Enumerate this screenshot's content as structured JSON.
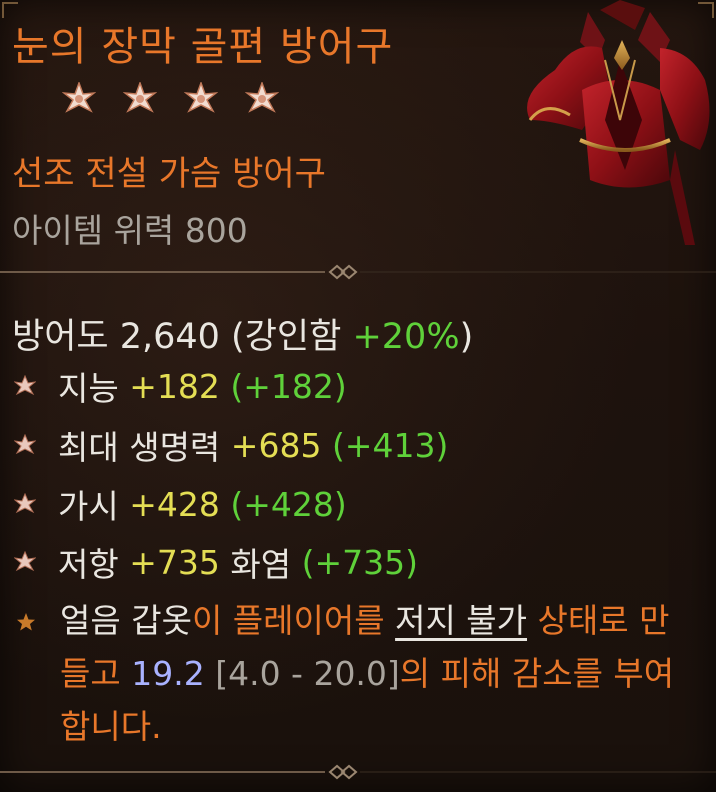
{
  "item": {
    "name": "눈의 장막 골편 방어구",
    "type": "선조 전설 가슴 방어구",
    "item_power_label": "아이템 위력 800",
    "stars": 4
  },
  "stats": {
    "armor_label": "방어도 2,640 (강인함",
    "armor_bonus": "+20%",
    "armor_close": ")",
    "affixes": [
      {
        "name": "지능",
        "value": "+182",
        "bonus": "(+182)"
      },
      {
        "name": "최대 생명력",
        "value": "+685",
        "bonus": "(+413)"
      },
      {
        "name": "가시",
        "value": "+428",
        "bonus": "(+428)"
      },
      {
        "name": "저항",
        "value": "+735",
        "suffix": "화염",
        "bonus": "(+735)"
      }
    ]
  },
  "legendary": {
    "part1": "얼음 갑옷",
    "part2": "이 플레이어를 ",
    "keyword": "저지 불가",
    "part3": " 상태로 만들고 ",
    "value": "19.2",
    "range": "[4.0 - 20.0]",
    "part4": "의 피해 감소를 부여합니다."
  },
  "colors": {
    "orange": "#e8772a",
    "green": "#5fd13a",
    "yellow": "#e4de54",
    "blue": "#a9b2ff",
    "grey": "#a9a49d"
  },
  "icons": {
    "star": "greater-affix-star-icon",
    "bullet": "affix-bullet-icon",
    "legendary_bullet": "legendary-star-icon",
    "item_image": "chest-armor-image"
  }
}
